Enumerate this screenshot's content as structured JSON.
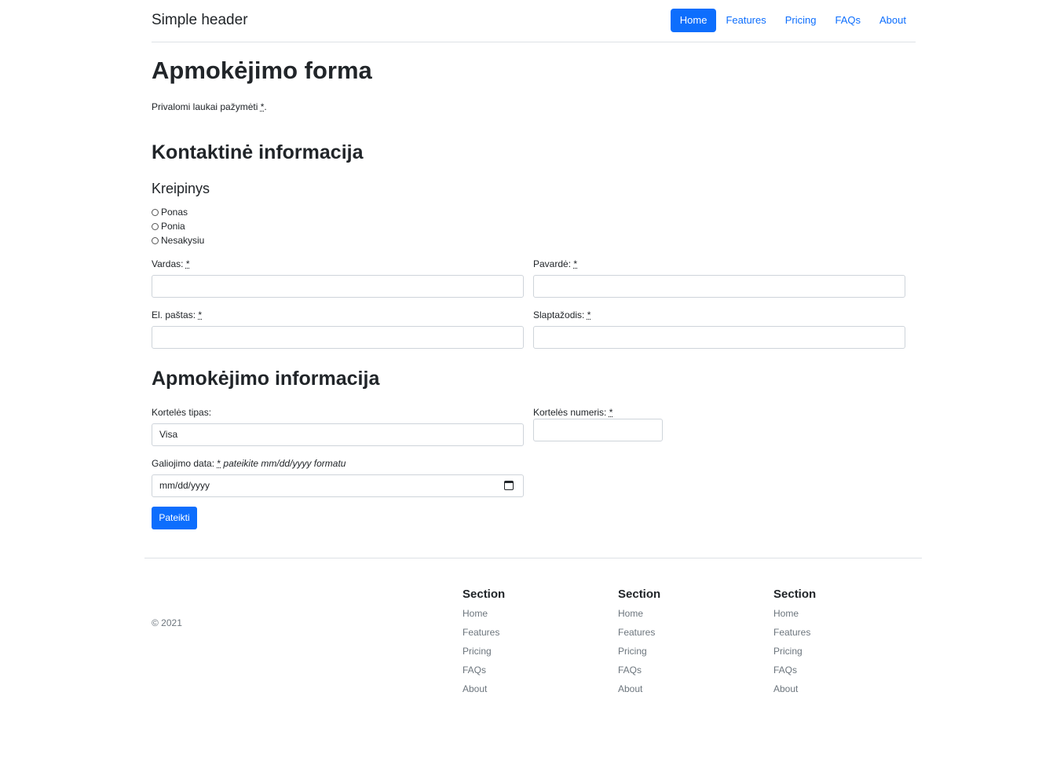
{
  "header": {
    "brand": "Simple header",
    "nav": [
      {
        "label": "Home",
        "active": true
      },
      {
        "label": "Features",
        "active": false
      },
      {
        "label": "Pricing",
        "active": false
      },
      {
        "label": "FAQs",
        "active": false
      },
      {
        "label": "About",
        "active": false
      }
    ]
  },
  "page": {
    "title": "Apmokėjimo forma",
    "required_note": "Privalomi laukai pažymėti",
    "required_star": "*",
    "required_end": "."
  },
  "contact": {
    "heading": "Kontaktinė informacija",
    "salutation_label": "Kreipinys",
    "salutations": [
      "Ponas",
      "Ponia",
      "Nesakysiu"
    ],
    "first_name_label": "Vardas:",
    "last_name_label": "Pavardė:",
    "email_label": "El. paštas:",
    "password_label": "Slaptažodis:",
    "first_name_value": "",
    "last_name_value": "",
    "email_value": "",
    "password_value": ""
  },
  "payment": {
    "heading": "Apmokėjimo informacija",
    "card_type_label": "Kortelės tipas:",
    "card_type_value": "Visa",
    "card_number_label": "Kortelės numeris:",
    "card_number_value": "",
    "expiry_label": "Galiojimo data:",
    "expiry_hint": "pateikite mm/dd/yyyy formatu",
    "expiry_placeholder": "mm/dd/yyyy",
    "submit_label": "Pateikti",
    "star": "*"
  },
  "footer": {
    "copyright": "© 2021",
    "columns": [
      {
        "heading": "Section",
        "links": [
          "Home",
          "Features",
          "Pricing",
          "FAQs",
          "About"
        ]
      },
      {
        "heading": "Section",
        "links": [
          "Home",
          "Features",
          "Pricing",
          "FAQs",
          "About"
        ]
      },
      {
        "heading": "Section",
        "links": [
          "Home",
          "Features",
          "Pricing",
          "FAQs",
          "About"
        ]
      }
    ]
  },
  "colors": {
    "primary": "#0d6efd",
    "text": "#212529",
    "muted": "#6c757d",
    "border": "#dee2e6"
  }
}
